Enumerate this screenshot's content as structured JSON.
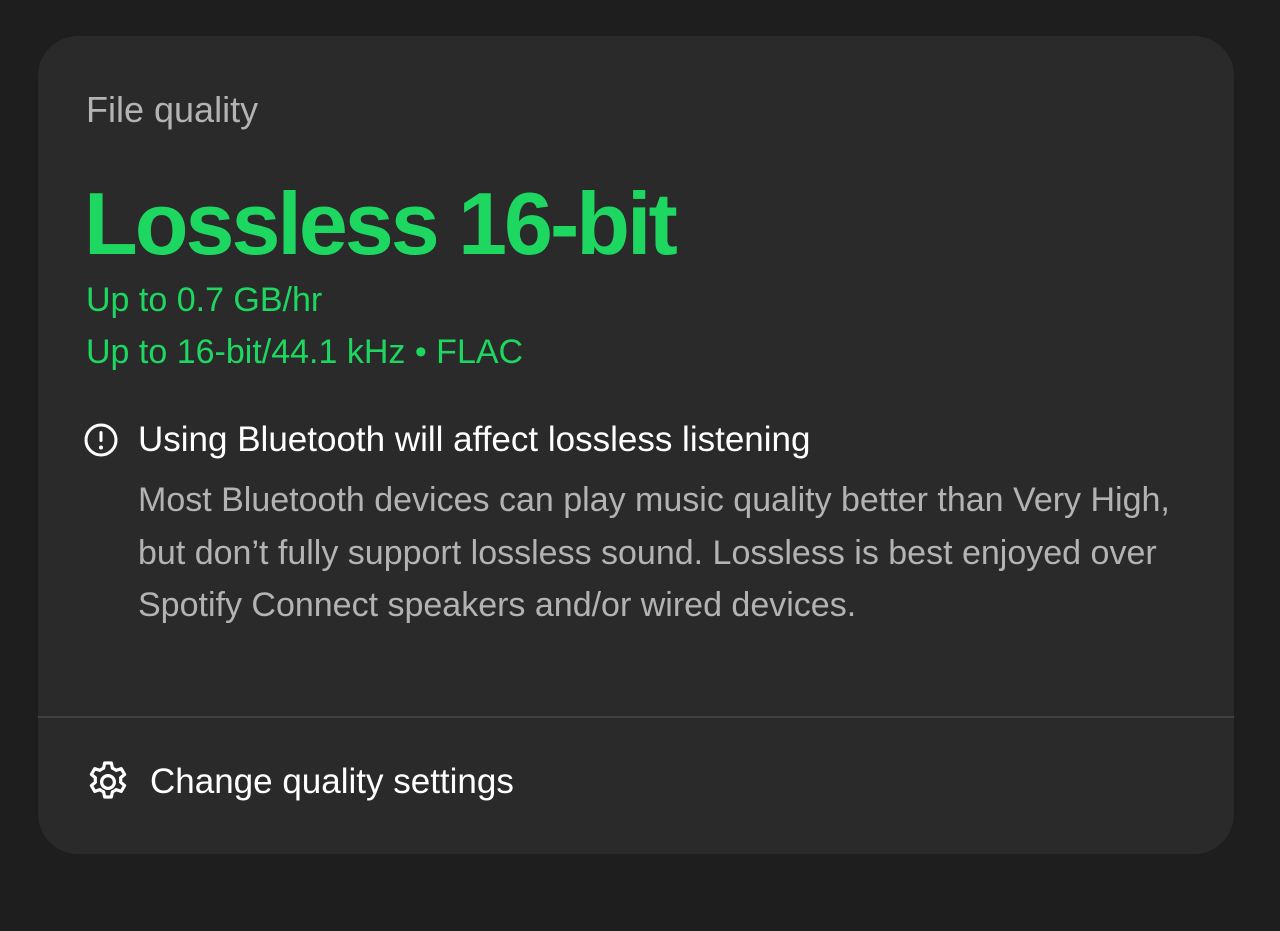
{
  "card": {
    "label": "File quality",
    "quality_title": "Lossless 16-bit",
    "details": [
      "Up to 0.7 GB/hr",
      "Up to 16-bit/44.1 kHz • FLAC"
    ],
    "warning": {
      "icon": "exclamation-circle-icon",
      "title": "Using Bluetooth will affect lossless listening",
      "body": "Most Bluetooth devices can play music quality better than Very High, but don’t fully support lossless sound. Lossless is best enjoyed over Spotify Connect speakers and/or wired devices."
    },
    "settings_link": {
      "icon": "gear-icon",
      "label": "Change quality settings"
    }
  },
  "colors": {
    "background": "#1e1e1e",
    "card": "#2a2a2a",
    "accent_green": "#1ed760",
    "text_primary": "#ffffff",
    "text_secondary": "#b3b3b3",
    "divider": "#404040"
  }
}
